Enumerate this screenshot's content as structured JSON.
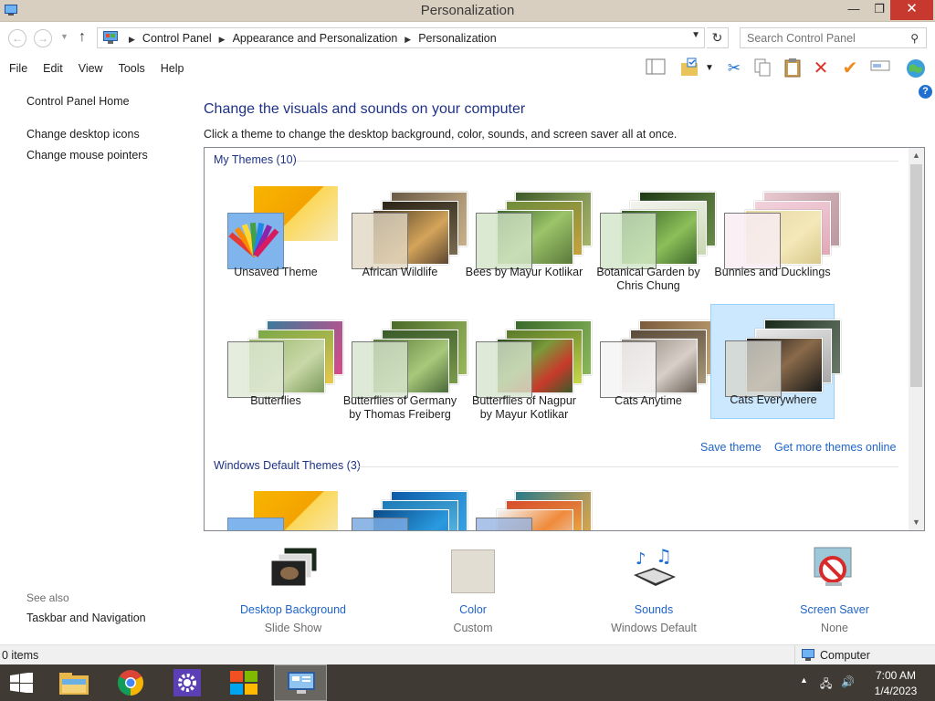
{
  "window": {
    "title": "Personalization",
    "min_glyph": "—",
    "max_glyph": "❐",
    "close_glyph": "✕"
  },
  "address": {
    "breadcrumbs": [
      "Control Panel",
      "Appearance and Personalization",
      "Personalization"
    ],
    "search_placeholder": "Search Control Panel"
  },
  "menu": [
    "File",
    "Edit",
    "View",
    "Tools",
    "Help"
  ],
  "toolbar_icons": [
    "layout-icon",
    "properties-folder-icon",
    "cut-icon",
    "copy-icon",
    "paste-icon",
    "delete-icon",
    "checkmark-icon",
    "rename-icon",
    "globe-icon"
  ],
  "left_pane": {
    "home": "Control Panel Home",
    "links": [
      "Change desktop icons",
      "Change mouse pointers"
    ],
    "see_also_label": "See also",
    "see_also_links": [
      "Taskbar and Navigation"
    ]
  },
  "main": {
    "title": "Change the visuals and sounds on your computer",
    "description": "Click a theme to change the desktop background, color, sounds, and screen saver all at once."
  },
  "themes": {
    "my_themes_header": "My Themes (10)",
    "my_themes": [
      {
        "line1": "Unsaved Theme",
        "line2": "",
        "selected": false
      },
      {
        "line1": "African Wildlife",
        "line2": "",
        "selected": false
      },
      {
        "line1": "Bees by Mayur Kotlikar",
        "line2": "",
        "selected": false
      },
      {
        "line1": "Botanical Garden by",
        "line2": "Chris Chung",
        "selected": false
      },
      {
        "line1": "Bunnies and Ducklings",
        "line2": "",
        "selected": false
      },
      {
        "line1": "Butterflies",
        "line2": "",
        "selected": false
      },
      {
        "line1": "Butterflies of Germany",
        "line2": "by Thomas Freiberg",
        "selected": false
      },
      {
        "line1": "Butterflies of Nagpur",
        "line2": "by Mayur Kotlikar",
        "selected": false
      },
      {
        "line1": "Cats Anytime",
        "line2": "",
        "selected": false
      },
      {
        "line1": "Cats Everywhere",
        "line2": "",
        "selected": true
      }
    ],
    "save_theme": "Save theme",
    "get_more": "Get more themes online",
    "windows_default_header": "Windows Default Themes (3)"
  },
  "options": [
    {
      "link": "Desktop Background",
      "value": "Slide Show"
    },
    {
      "link": "Color",
      "value": "Custom"
    },
    {
      "link": "Sounds",
      "value": "Windows Default"
    },
    {
      "link": "Screen Saver",
      "value": "None"
    }
  ],
  "status": {
    "items": "0 items",
    "location": "Computer"
  },
  "taskbar": {
    "time": "7:00 AM",
    "date": "1/4/2023"
  },
  "colors": {
    "link_blue": "#1e64c8",
    "heading_blue": "#1e3287",
    "selection": "#cce8ff",
    "close_red": "#c7392f",
    "taskbar": "#3f3b34"
  }
}
